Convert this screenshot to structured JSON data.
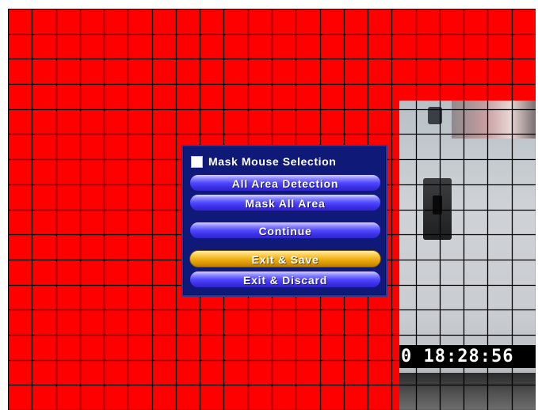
{
  "screen": {
    "mask_color": "#ff0000",
    "grid_color": "#000000",
    "grid_cols": 22,
    "grid_rows": 16,
    "timestamp": "0 18:28:56"
  },
  "menu": {
    "mask_mouse_selection": {
      "label": "Mask Mouse Selection",
      "checked": false
    },
    "buttons": [
      {
        "id": "all-area-detection",
        "label": "All Area Detection",
        "highlighted": false
      },
      {
        "id": "mask-all-area",
        "label": "Mask All Area",
        "highlighted": false
      },
      {
        "id": "continue",
        "label": "Continue",
        "highlighted": false
      },
      {
        "id": "exit-save",
        "label": "Exit & Save",
        "highlighted": true
      },
      {
        "id": "exit-discard",
        "label": "Exit & Discard",
        "highlighted": false
      }
    ],
    "colors": {
      "panel": "#0f1a78",
      "button": "#4a40ff",
      "highlight": "#f0b21a"
    }
  }
}
